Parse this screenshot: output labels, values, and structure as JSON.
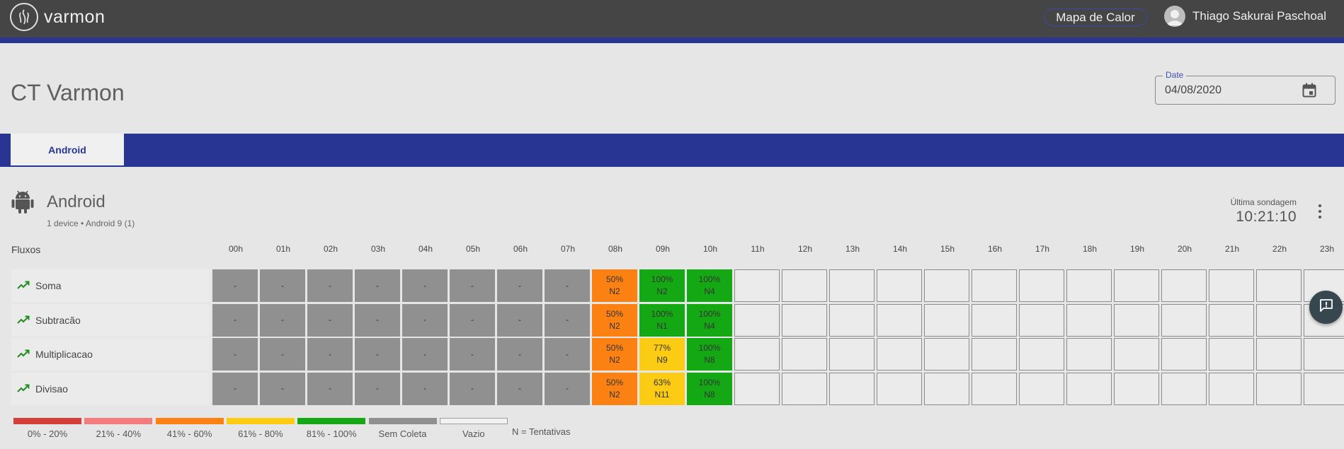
{
  "app": {
    "name": "varmon"
  },
  "header": {
    "heatmap_button": "Mapa de Calor",
    "user_name": "Thiago Sakurai Paschoal"
  },
  "page": {
    "title": "CT Varmon"
  },
  "date": {
    "label": "Date",
    "value": "04/08/2020"
  },
  "tabs": [
    {
      "label": "Android",
      "active": true
    }
  ],
  "section": {
    "title": "Android",
    "subtitle": "1 device • Android 9 (1)",
    "last_probe_label": "Última sondagem",
    "last_probe_time": "10:21:10"
  },
  "grid": {
    "flows_header": "Fluxos",
    "hours": [
      "00h",
      "01h",
      "02h",
      "03h",
      "04h",
      "05h",
      "06h",
      "07h",
      "08h",
      "09h",
      "10h",
      "11h",
      "12h",
      "13h",
      "14h",
      "15h",
      "16h",
      "17h",
      "18h",
      "19h",
      "20h",
      "21h",
      "22h",
      "23h"
    ],
    "rows": [
      {
        "name": "Soma",
        "cells": [
          {
            "type": "gray",
            "pct": "-",
            "n": ""
          },
          {
            "type": "gray",
            "pct": "-",
            "n": ""
          },
          {
            "type": "gray",
            "pct": "-",
            "n": ""
          },
          {
            "type": "gray",
            "pct": "-",
            "n": ""
          },
          {
            "type": "gray",
            "pct": "-",
            "n": ""
          },
          {
            "type": "gray",
            "pct": "-",
            "n": ""
          },
          {
            "type": "gray",
            "pct": "-",
            "n": ""
          },
          {
            "type": "gray",
            "pct": "-",
            "n": ""
          },
          {
            "type": "orange",
            "pct": "50%",
            "n": "N2"
          },
          {
            "type": "green",
            "pct": "100%",
            "n": "N2"
          },
          {
            "type": "green",
            "pct": "100%",
            "n": "N4"
          },
          {
            "type": "empty",
            "pct": "",
            "n": ""
          },
          {
            "type": "empty",
            "pct": "",
            "n": ""
          },
          {
            "type": "empty",
            "pct": "",
            "n": ""
          },
          {
            "type": "empty",
            "pct": "",
            "n": ""
          },
          {
            "type": "empty",
            "pct": "",
            "n": ""
          },
          {
            "type": "empty",
            "pct": "",
            "n": ""
          },
          {
            "type": "empty",
            "pct": "",
            "n": ""
          },
          {
            "type": "empty",
            "pct": "",
            "n": ""
          },
          {
            "type": "empty",
            "pct": "",
            "n": ""
          },
          {
            "type": "empty",
            "pct": "",
            "n": ""
          },
          {
            "type": "empty",
            "pct": "",
            "n": ""
          },
          {
            "type": "empty",
            "pct": "",
            "n": ""
          },
          {
            "type": "empty",
            "pct": "",
            "n": ""
          }
        ]
      },
      {
        "name": "Subtracão",
        "cells": [
          {
            "type": "gray",
            "pct": "-",
            "n": ""
          },
          {
            "type": "gray",
            "pct": "-",
            "n": ""
          },
          {
            "type": "gray",
            "pct": "-",
            "n": ""
          },
          {
            "type": "gray",
            "pct": "-",
            "n": ""
          },
          {
            "type": "gray",
            "pct": "-",
            "n": ""
          },
          {
            "type": "gray",
            "pct": "-",
            "n": ""
          },
          {
            "type": "gray",
            "pct": "-",
            "n": ""
          },
          {
            "type": "gray",
            "pct": "-",
            "n": ""
          },
          {
            "type": "orange",
            "pct": "50%",
            "n": "N2"
          },
          {
            "type": "green",
            "pct": "100%",
            "n": "N1"
          },
          {
            "type": "green",
            "pct": "100%",
            "n": "N4"
          },
          {
            "type": "empty",
            "pct": "",
            "n": ""
          },
          {
            "type": "empty",
            "pct": "",
            "n": ""
          },
          {
            "type": "empty",
            "pct": "",
            "n": ""
          },
          {
            "type": "empty",
            "pct": "",
            "n": ""
          },
          {
            "type": "empty",
            "pct": "",
            "n": ""
          },
          {
            "type": "empty",
            "pct": "",
            "n": ""
          },
          {
            "type": "empty",
            "pct": "",
            "n": ""
          },
          {
            "type": "empty",
            "pct": "",
            "n": ""
          },
          {
            "type": "empty",
            "pct": "",
            "n": ""
          },
          {
            "type": "empty",
            "pct": "",
            "n": ""
          },
          {
            "type": "empty",
            "pct": "",
            "n": ""
          },
          {
            "type": "empty",
            "pct": "",
            "n": ""
          },
          {
            "type": "empty",
            "pct": "",
            "n": ""
          }
        ]
      },
      {
        "name": "Multiplicacao",
        "cells": [
          {
            "type": "gray",
            "pct": "-",
            "n": ""
          },
          {
            "type": "gray",
            "pct": "-",
            "n": ""
          },
          {
            "type": "gray",
            "pct": "-",
            "n": ""
          },
          {
            "type": "gray",
            "pct": "-",
            "n": ""
          },
          {
            "type": "gray",
            "pct": "-",
            "n": ""
          },
          {
            "type": "gray",
            "pct": "-",
            "n": ""
          },
          {
            "type": "gray",
            "pct": "-",
            "n": ""
          },
          {
            "type": "gray",
            "pct": "-",
            "n": ""
          },
          {
            "type": "orange",
            "pct": "50%",
            "n": "N2"
          },
          {
            "type": "yellow",
            "pct": "77%",
            "n": "N9"
          },
          {
            "type": "green",
            "pct": "100%",
            "n": "N8"
          },
          {
            "type": "empty",
            "pct": "",
            "n": ""
          },
          {
            "type": "empty",
            "pct": "",
            "n": ""
          },
          {
            "type": "empty",
            "pct": "",
            "n": ""
          },
          {
            "type": "empty",
            "pct": "",
            "n": ""
          },
          {
            "type": "empty",
            "pct": "",
            "n": ""
          },
          {
            "type": "empty",
            "pct": "",
            "n": ""
          },
          {
            "type": "empty",
            "pct": "",
            "n": ""
          },
          {
            "type": "empty",
            "pct": "",
            "n": ""
          },
          {
            "type": "empty",
            "pct": "",
            "n": ""
          },
          {
            "type": "empty",
            "pct": "",
            "n": ""
          },
          {
            "type": "empty",
            "pct": "",
            "n": ""
          },
          {
            "type": "empty",
            "pct": "",
            "n": ""
          },
          {
            "type": "empty",
            "pct": "",
            "n": ""
          }
        ]
      },
      {
        "name": "Divisao",
        "cells": [
          {
            "type": "gray",
            "pct": "-",
            "n": ""
          },
          {
            "type": "gray",
            "pct": "-",
            "n": ""
          },
          {
            "type": "gray",
            "pct": "-",
            "n": ""
          },
          {
            "type": "gray",
            "pct": "-",
            "n": ""
          },
          {
            "type": "gray",
            "pct": "-",
            "n": ""
          },
          {
            "type": "gray",
            "pct": "-",
            "n": ""
          },
          {
            "type": "gray",
            "pct": "-",
            "n": ""
          },
          {
            "type": "gray",
            "pct": "-",
            "n": ""
          },
          {
            "type": "orange",
            "pct": "50%",
            "n": "N2"
          },
          {
            "type": "yellow",
            "pct": "63%",
            "n": "N11"
          },
          {
            "type": "green",
            "pct": "100%",
            "n": "N8"
          },
          {
            "type": "empty",
            "pct": "",
            "n": ""
          },
          {
            "type": "empty",
            "pct": "",
            "n": ""
          },
          {
            "type": "empty",
            "pct": "",
            "n": ""
          },
          {
            "type": "empty",
            "pct": "",
            "n": ""
          },
          {
            "type": "empty",
            "pct": "",
            "n": ""
          },
          {
            "type": "empty",
            "pct": "",
            "n": ""
          },
          {
            "type": "empty",
            "pct": "",
            "n": ""
          },
          {
            "type": "empty",
            "pct": "",
            "n": ""
          },
          {
            "type": "empty",
            "pct": "",
            "n": ""
          },
          {
            "type": "empty",
            "pct": "",
            "n": ""
          },
          {
            "type": "empty",
            "pct": "",
            "n": ""
          },
          {
            "type": "empty",
            "pct": "",
            "n": ""
          },
          {
            "type": "empty",
            "pct": "",
            "n": ""
          }
        ]
      }
    ]
  },
  "legend": {
    "items": [
      {
        "label": "0% - 20%",
        "color": "#d43f3a"
      },
      {
        "label": "21% - 40%",
        "color": "#f47c7c"
      },
      {
        "label": "41% - 60%",
        "color": "#fb8212"
      },
      {
        "label": "61% - 80%",
        "color": "#fccb14"
      },
      {
        "label": "81% - 100%",
        "color": "#14a814"
      },
      {
        "label": "Sem Coleta",
        "color": "#909090"
      },
      {
        "label": "Vazio",
        "color": "#f2f2f2"
      }
    ],
    "note": "N = Tentativas"
  },
  "colors": {
    "accent": "#283593",
    "topbar": "#454545"
  },
  "icons": {
    "logo": "varmon-logo-icon",
    "avatar": "account-circle-icon",
    "calendar": "calendar-icon",
    "android": "android-icon",
    "trend": "trending-up-icon",
    "more": "more-vert-icon",
    "feedback": "feedback-icon"
  }
}
